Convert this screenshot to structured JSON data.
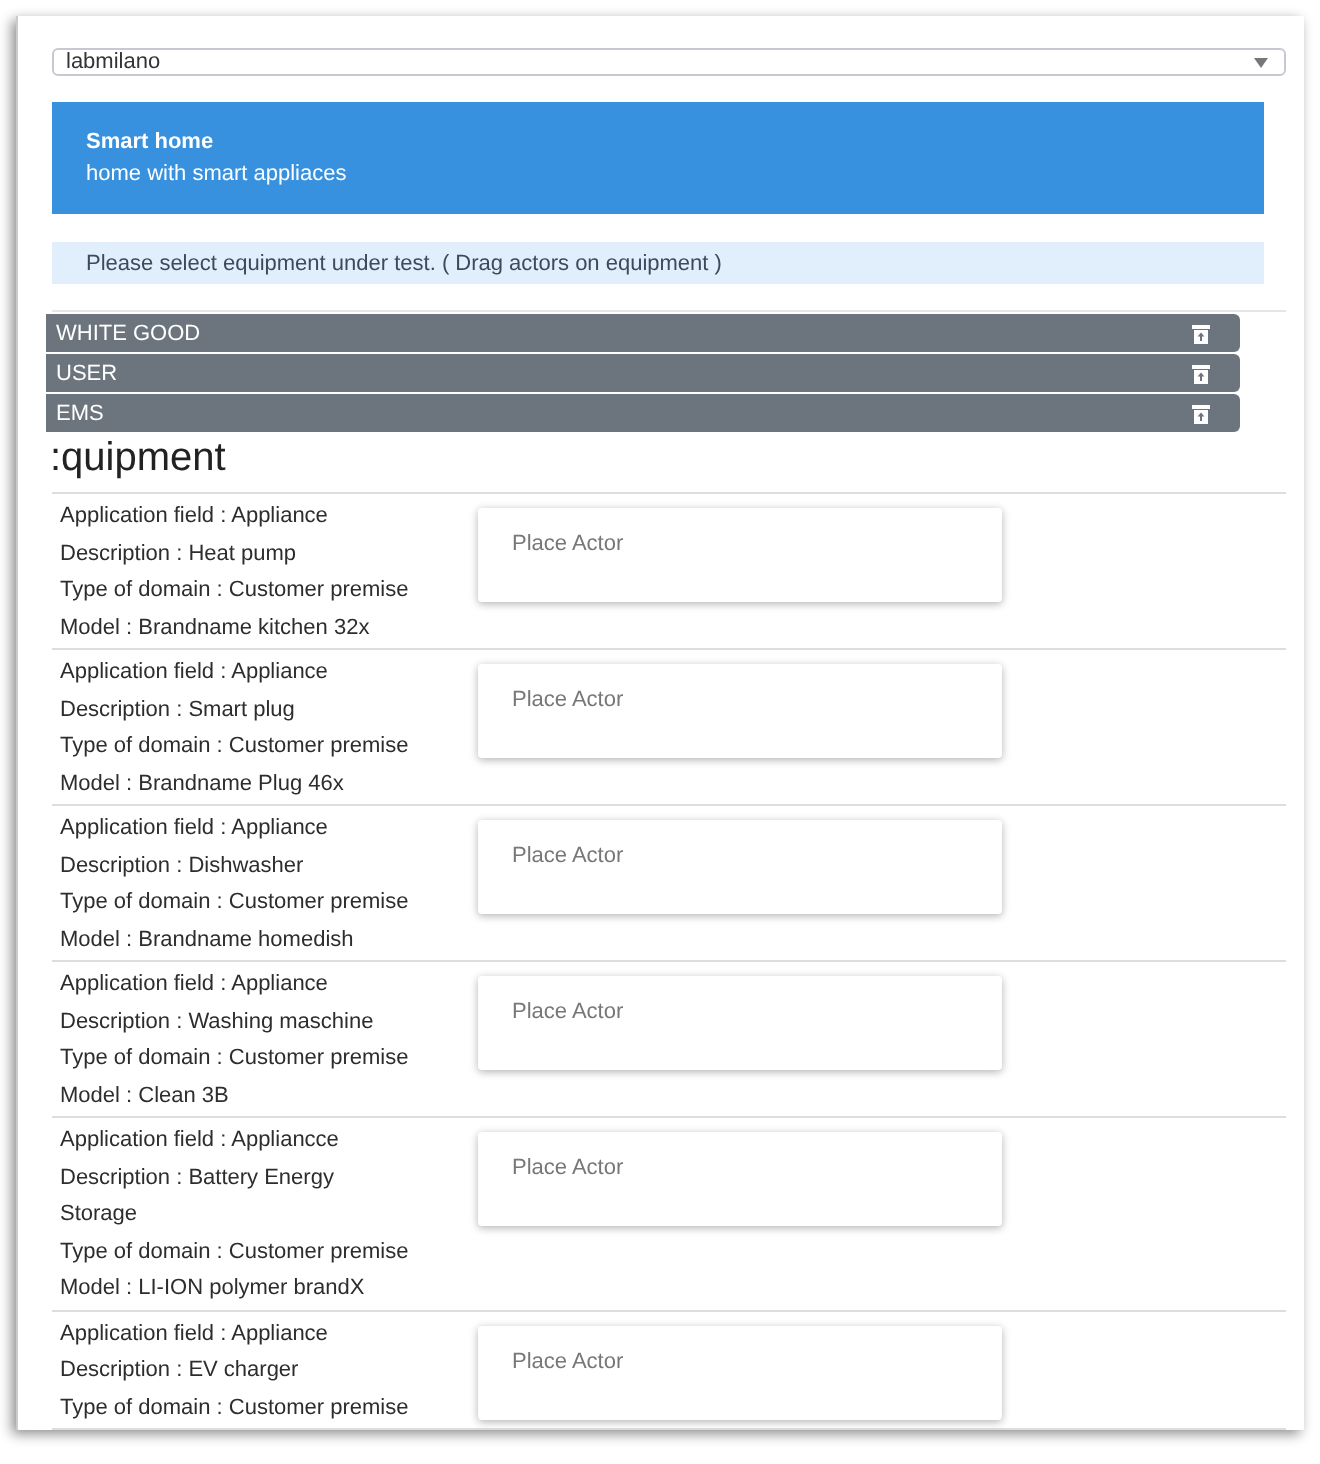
{
  "site_select": {
    "value": "labmilano"
  },
  "scenario": {
    "title": "Smart home",
    "description": "home with smart appliaces"
  },
  "info": "Please select equipment under test. ( Drag actors on equipment )",
  "actors": [
    {
      "label": "WHITE GOOD"
    },
    {
      "label": "USER"
    },
    {
      "label": "EMS"
    }
  ],
  "heading": ":quipment",
  "equipment": [
    {
      "lines": [
        "Application field : Appliance",
        "Description : Heat pump",
        "Type of domain : Customer premise",
        "Model : Brandname kitchen 32x"
      ],
      "drop_label": "Place Actor"
    },
    {
      "lines": [
        "Application field : Appliance",
        "Description : Smart plug",
        "Type of domain : Customer premise",
        "Model : Brandname Plug 46x"
      ],
      "drop_label": "Place Actor"
    },
    {
      "lines": [
        "Application field : Appliance",
        "Description : Dishwasher",
        "Type of domain : Customer premise",
        "Model : Brandname homedish"
      ],
      "drop_label": "Place Actor"
    },
    {
      "lines": [
        "Application field : Appliance",
        "Description : Washing maschine",
        "Type of domain : Customer premise",
        "Model : Clean 3B"
      ],
      "drop_label": "Place Actor"
    },
    {
      "lines": [
        "Application field : Appliancce",
        "Description : Battery Energy",
        "Storage",
        "Type of domain : Customer premise",
        "Model : LI-ION polymer brandX"
      ],
      "drop_label": "Place Actor"
    },
    {
      "lines": [
        "Application field : Appliance",
        "Description : EV charger",
        "Type of domain : Customer premise"
      ],
      "drop_label": "Place Actor"
    }
  ]
}
